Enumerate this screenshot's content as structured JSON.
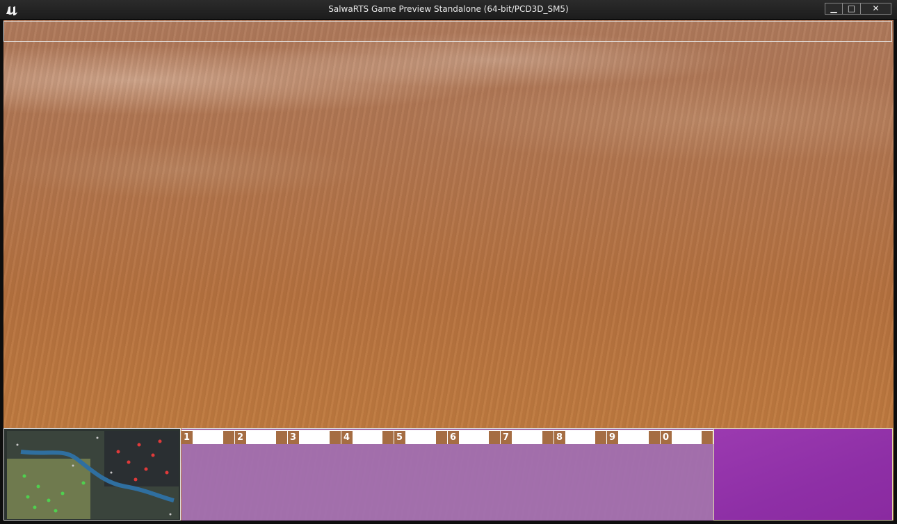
{
  "window": {
    "title": "SalwaRTS Game Preview Standalone (64-bit/PCD3D_SM5)",
    "logo": "unreal-engine-logo",
    "buttons": {
      "minimize": "▁",
      "maximize": "□",
      "close": "✕"
    }
  },
  "hud": {
    "hotkeys": [
      "1",
      "2",
      "3",
      "4",
      "5",
      "6",
      "7",
      "8",
      "9",
      "0"
    ],
    "colors": {
      "slot": "#a56d43",
      "hotbar": "#a06eb4",
      "portrait": "#8e2fa6",
      "terrain": "#b6723f"
    }
  }
}
